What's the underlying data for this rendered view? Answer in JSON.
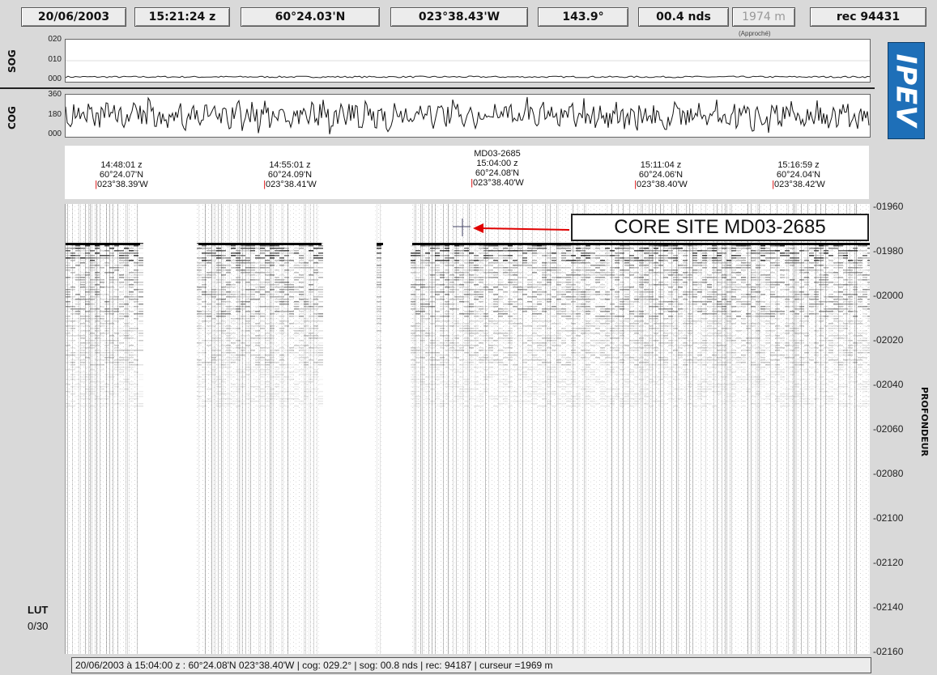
{
  "topbar": {
    "date": "20/06/2003",
    "time": "15:21:24 z",
    "lat": "60°24.03'N",
    "lon": "023°38.43'W",
    "heading": "143.9°",
    "speed": "00.4 nds",
    "depth": "1974 m",
    "depth_note": "(Approché)",
    "rec": "rec 94431"
  },
  "sog": {
    "label": "SOG",
    "ticks": [
      "020",
      "010",
      "000"
    ]
  },
  "cog": {
    "label": "COG",
    "ticks": [
      "360",
      "180",
      "000"
    ]
  },
  "logo": "IPEV",
  "nav_markers": [
    {
      "site": "",
      "time": "14:48:01 z",
      "lat": "60°24.07'N",
      "lon": "023°38.39'W"
    },
    {
      "site": "",
      "time": "14:55:01 z",
      "lat": "60°24.09'N",
      "lon": "023°38.41'W"
    },
    {
      "site": "MD03-2685",
      "time": "15:04:00 z",
      "lat": "60°24.08'N",
      "lon": "023°38.40'W"
    },
    {
      "site": "",
      "time": "15:11:04 z",
      "lat": "60°24.06'N",
      "lon": "023°38.40'W"
    },
    {
      "site": "",
      "time": "15:16:59 z",
      "lat": "60°24.04'N",
      "lon": "023°38.42'W"
    }
  ],
  "annotation": "CORE SITE MD03-2685",
  "depth_axis": {
    "label": "PROFONDEUR",
    "ticks": [
      "-01960",
      "-01980",
      "-02000",
      "-02020",
      "-02040",
      "-02060",
      "-02080",
      "-02100",
      "-02120",
      "-02140",
      "-02160"
    ]
  },
  "lut": {
    "label": "LUT",
    "value": "0/30"
  },
  "status_bar": "20/06/2003 à 15:04:00 z :  60°24.08'N  023°38.40'W | cog: 029.2° | sog: 00.8 nds | rec: 94187 | curseur =1969 m",
  "colors": {
    "logo_blue": "#1e6fb8",
    "arrow_red": "#e00000",
    "marker_red": "#dd0000"
  }
}
